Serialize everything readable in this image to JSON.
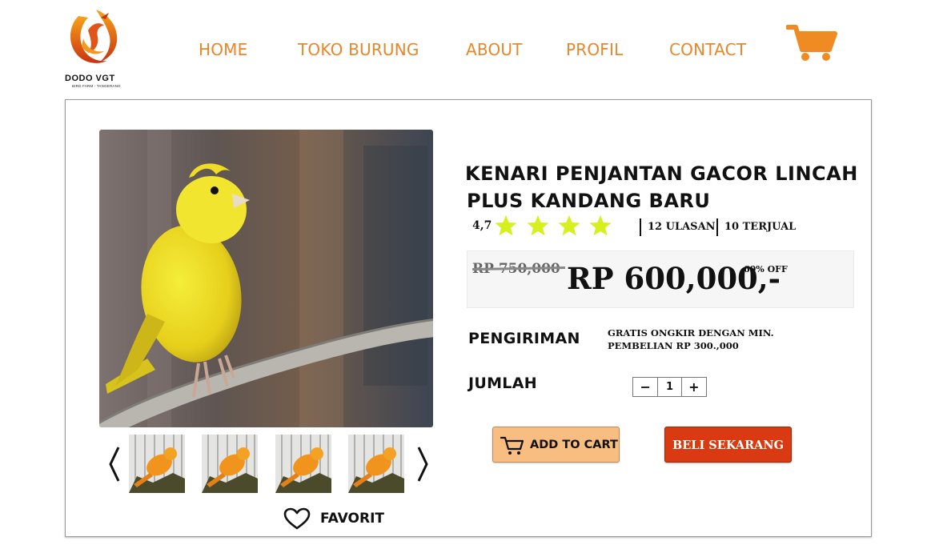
{
  "brand": {
    "name": "DODO VGT",
    "tagline": "BIRD FARM - TANGERANG"
  },
  "nav": {
    "items": [
      {
        "label": "HOME"
      },
      {
        "label": "TOKO BURUNG"
      },
      {
        "label": "ABOUT"
      },
      {
        "label": "PROFIL"
      },
      {
        "label": "CONTACT"
      }
    ],
    "cart_icon": "shopping-cart-icon"
  },
  "colors": {
    "accent": "#e8862a",
    "star": "#d6ef1e",
    "add_to_cart_bg": "#f8bd80",
    "buy_now_bg": "#d93a12",
    "price_box_bg": "#f7f6f6"
  },
  "gallery": {
    "thumbnail_count": 4,
    "prev_icon": "chevron-left-icon",
    "next_icon": "chevron-right-icon"
  },
  "favorite": {
    "label": "FAVORIT",
    "icon": "heart-icon"
  },
  "product": {
    "title_line1": "KENARI PENJANTAN GACOR LINCAH",
    "title_line2": "PLUS KANDANG BARU",
    "rating": "4,7",
    "rating_value": 4.7,
    "rating_max": 5,
    "reviews": "12 ULASAN",
    "sold": "10 TERJUAL",
    "old_price": "RP 750,000",
    "price": "RP 600,000,-",
    "discount": "60% OFF"
  },
  "shipping": {
    "label": "PENGIRIMAN",
    "line1": "GRATIS ONGKIR DENGAN MIN.",
    "line2": "PEMBELIAN RP 300.,000"
  },
  "quantity": {
    "label": "JUMLAH",
    "minus": "−",
    "value": "1",
    "plus": "+"
  },
  "actions": {
    "add_to_cart": "ADD TO CART",
    "add_to_cart_icon": "shopping-cart-icon",
    "buy_now": "BELI SEKARANG"
  }
}
